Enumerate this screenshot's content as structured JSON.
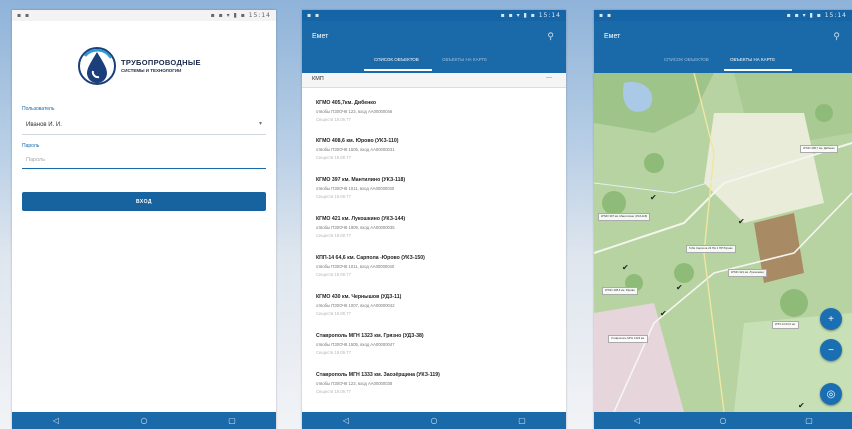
{
  "status_bar": {
    "left": "▪ ▪",
    "right": "▪ ▪ ▾ ▮ ▪ 15:14"
  },
  "nav_bar": {
    "back": "◁",
    "home": "○",
    "recent": "▢"
  },
  "login": {
    "logo_title": "ТРУБОПРОВОДНЫЕ",
    "logo_subtitle": "СИСТЕМЫ И ТЕХНОЛОГИИ",
    "user_label": "Пользователь",
    "user_value": "Иванов И. И.",
    "password_label": "Пароль",
    "password_placeholder": "Пароль",
    "login_button": "ВХОД",
    "dropdown_arrow": "▾"
  },
  "list_screen": {
    "title": "Емет",
    "tabs": [
      "СПИСОК ОБЪЕКТОВ",
      "ОБЪЕКТЫ НА КАРТЕ"
    ],
    "filter_value": "КМП",
    "filter_clear": "—",
    "items": [
      {
        "title": "КГМО 405,7км. Дибенко",
        "line1": "отвобы ПЗ0ОЧ8 123, вход АА00000046",
        "line2": "Сеществ 19.09.77"
      },
      {
        "title": "КГМО 408,6 км. Юрово (УКЗ-110)",
        "line1": "отвобы ПЗ0ОЧ8 1505, вход АА00000031",
        "line2": "Сеществ 19.09.77"
      },
      {
        "title": "КГМО 397 км. Мантилино (УКЗ-118)",
        "line1": "отвобы ПЗ0ОЧ8 1011, вход АА00000030",
        "line2": "Сеществ 19.09.77"
      },
      {
        "title": "КГМО 421 км. Лукошкино (УКЗ-144)",
        "line1": "отвобы ПЗ0ОЧ8 1909, вход АА00000035",
        "line2": "Сеществ 19.09.77"
      },
      {
        "title": "КПП-14 64,6 км. Сарпола -Юрово (УКЗ-150)",
        "line1": "отвобы ПЗ0ОЧ8 1011, вход АА00000040",
        "line2": "Сеществ 19.09.77"
      },
      {
        "title": "КГМО 430 км. Чернышов (УДЗ-11)",
        "line1": "отвобы ПЗ0ОЧ8 1007, вход АА00000042",
        "line2": "Сеществ 19.09.77"
      },
      {
        "title": "Ставрополь МГН 1323 км. Грязно (УДЗ-38)",
        "line1": "отвобы ПЗ0ОЧ8 1505, вход АА00000047",
        "line2": "Сеществ 19.09.77"
      },
      {
        "title": "Ставрополь МГН 1333 км. Заозёрщина (УКЗ-119)",
        "line1": "отвобы ПЗ0ОЧ8 123, вход АА00000038",
        "line2": "Сеществ 19.09.77"
      }
    ]
  },
  "map_screen": {
    "title": "Емет",
    "tabs": [
      "СПИСОК ОБЪЕКТОВ",
      "ОБЪЕКТЫ НА КАРТЕ"
    ],
    "zoom_in": "+",
    "zoom_out": "−",
    "locate": "◎",
    "labels": [
      "КГМО 397 км. Мантилино (УКЗ-118)",
      "Тоби Сарпола 23 ПА 1 ПР Юрово",
      "КГМО 405,7 км. Дибенко",
      "КГМО 421 км. Лукошкино",
      "КГМО 408,6 км. Юрово",
      "КПП-14 64,6 км.",
      "Ставрополь МГН 1323 км."
    ]
  },
  "colors": {
    "primary": "#1a69a8",
    "fab": "#1a6fb3",
    "map_bg": "#bcd8a8"
  }
}
